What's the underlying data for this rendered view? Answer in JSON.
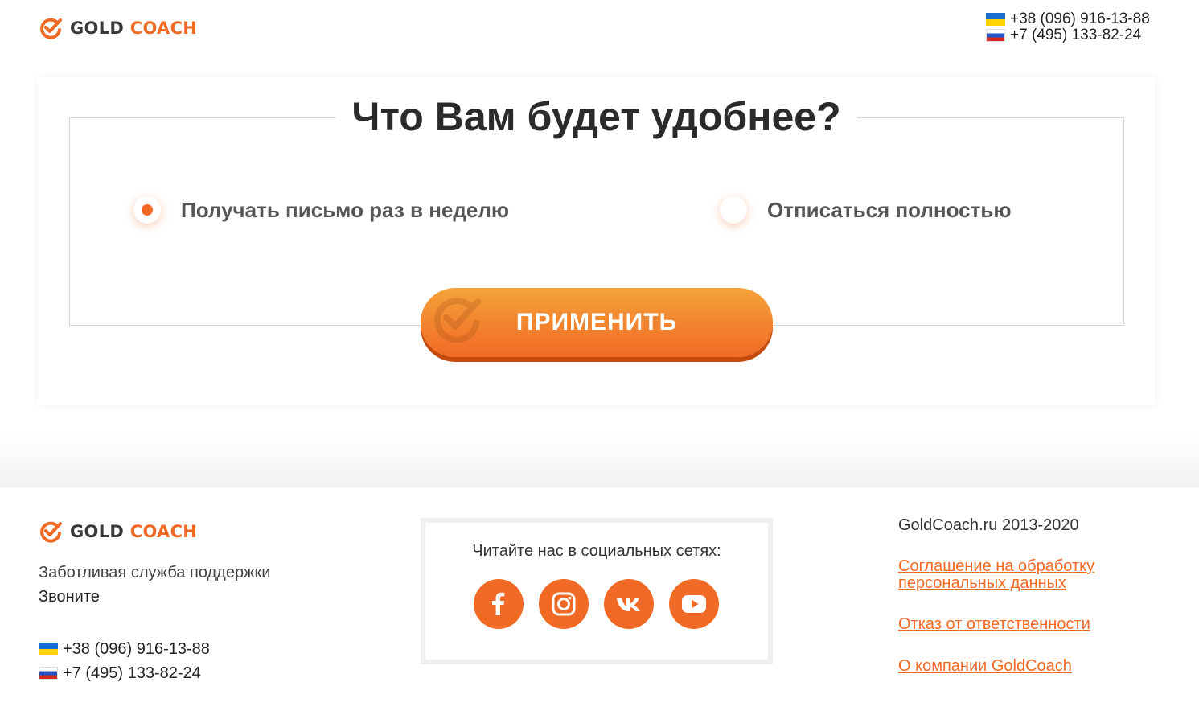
{
  "header": {
    "logo": {
      "gold": "GOLD",
      "coach": "COACH"
    },
    "phones": [
      {
        "flag": "flag-ua-icon",
        "number": "+38 (096) 916-13-88"
      },
      {
        "flag": "flag-ru-icon",
        "number": "+7 (495) 133-82-24"
      }
    ]
  },
  "form": {
    "title": "Что Вам будет удобнее?",
    "options": [
      {
        "label": "Получать письмо раз в неделю",
        "selected": true
      },
      {
        "label": "Отписаться полностью",
        "selected": false
      }
    ],
    "submit_label": "ПРИМЕНИТЬ"
  },
  "footer": {
    "logo": {
      "gold": "GOLD",
      "coach": "COACH"
    },
    "support": "Заботливая служба поддержки",
    "call": "Звоните",
    "phones": [
      {
        "flag": "flag-ua-icon",
        "number": "+38 (096) 916-13-88"
      },
      {
        "flag": "flag-ru-icon",
        "number": "+7 (495) 133-82-24"
      }
    ],
    "social_title": "Читайте нас в социальных сетях:",
    "social": [
      "facebook-icon",
      "instagram-icon",
      "vk-icon",
      "youtube-icon"
    ],
    "copyright": "GoldCoach.ru 2013-2020",
    "links": [
      "Соглашение на обработку персональных данных",
      "Отказ от ответственности",
      "О компании GoldCoach"
    ]
  },
  "colors": {
    "accent": "#f16a25",
    "accent_light": "#f4a23a",
    "text_dark": "#2b2b2b"
  }
}
